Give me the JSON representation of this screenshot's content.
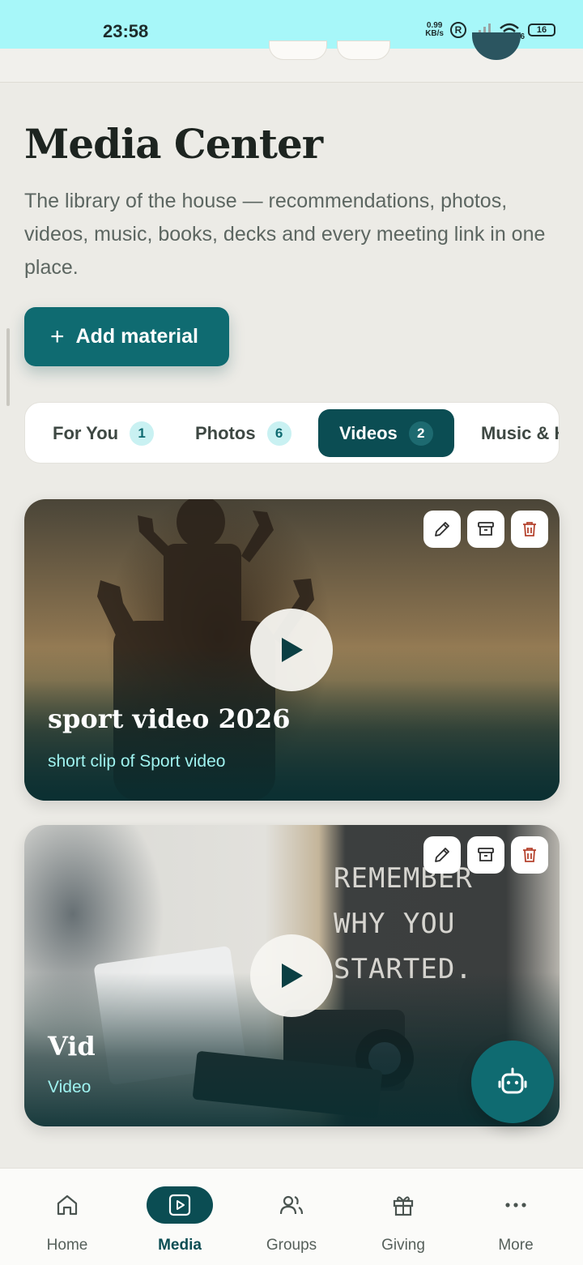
{
  "status_bar": {
    "time": "23:58",
    "net_speed_value": "0.99",
    "net_speed_unit": "KB/s",
    "roaming_badge": "R",
    "wifi_label": "6",
    "battery": "16"
  },
  "header": {
    "title": "Media Center",
    "subtitle": "The library of the house — recommendations, photos, videos, music, books, decks and every meeting link in one place."
  },
  "add_button": {
    "label": "Add material",
    "icon": "plus-icon"
  },
  "tabs": [
    {
      "label": "For You",
      "count": "1",
      "active": false
    },
    {
      "label": "Photos",
      "count": "6",
      "active": false
    },
    {
      "label": "Videos",
      "count": "2",
      "active": true
    },
    {
      "label": "Music & H",
      "count": "",
      "active": false
    }
  ],
  "videos": [
    {
      "title": "sport video 2026",
      "subtitle": "short clip of Sport video"
    },
    {
      "title": "Vid",
      "subtitle": "Video",
      "board_text": [
        "REMEMBER",
        "WHY YOU",
        "STARTED."
      ]
    }
  ],
  "card_actions": [
    "edit-icon",
    "archive-icon",
    "delete-icon"
  ],
  "fab": {
    "icon": "robot-icon"
  },
  "bottom_nav": [
    {
      "label": "Home",
      "icon": "home-icon",
      "active": false
    },
    {
      "label": "Media",
      "icon": "media-icon",
      "active": true
    },
    {
      "label": "Groups",
      "icon": "groups-icon",
      "active": false
    },
    {
      "label": "Giving",
      "icon": "gift-icon",
      "active": false
    },
    {
      "label": "More",
      "icon": "more-icon",
      "active": false
    }
  ],
  "colors": {
    "accent": "#0f6b71",
    "accent_dark": "#0b4d53",
    "status_bar": "#a7f7f9",
    "background": "#ecebe6",
    "delete": "#b5432e"
  }
}
